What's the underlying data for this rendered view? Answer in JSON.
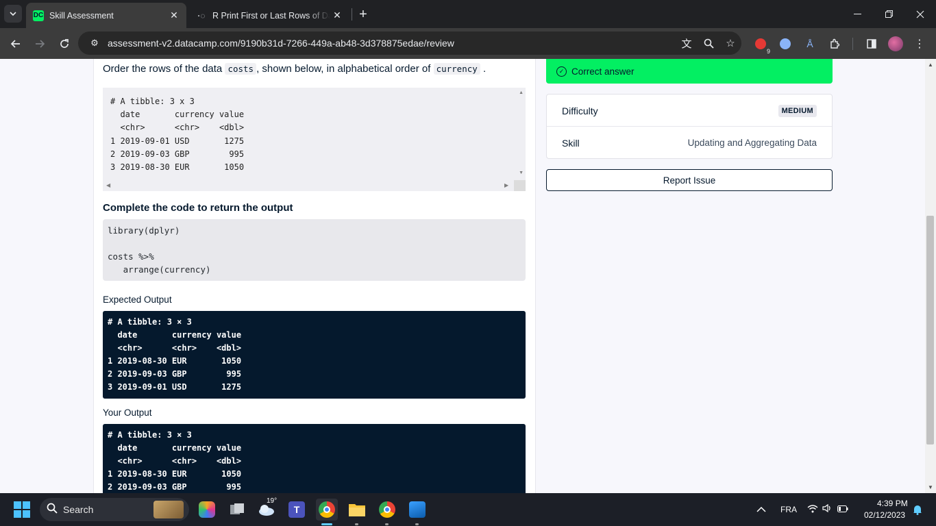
{
  "browser": {
    "tabs": [
      {
        "title": "Skill Assessment",
        "active": true
      },
      {
        "title": "R Print First or Last Rows of Da",
        "active": false
      }
    ],
    "url": "assessment-v2.datacamp.com/9190b31d-7266-449a-ab48-3d378875edae/review",
    "extension_badge": "9"
  },
  "question": {
    "text_before": "Order the rows of the data",
    "code1": "costs",
    "text_middle": ", shown below, in alphabetical order of",
    "code2": "currency",
    "text_after": ".",
    "data_preview": "# A tibble: 3 x 3\n  date       currency value\n  <chr>      <chr>    <dbl>\n1 2019-09-01 USD       1275\n2 2019-09-03 GBP        995\n3 2019-08-30 EUR       1050"
  },
  "complete": {
    "heading": "Complete the code to return the output",
    "code": "library(dplyr)\n\ncosts %>%\n   arrange(currency)"
  },
  "expected": {
    "heading": "Expected Output",
    "output": "# A tibble: 3 × 3\n  date       currency value\n  <chr>      <chr>    <dbl>\n1 2019-08-30 EUR       1050\n2 2019-09-03 GBP        995\n3 2019-09-01 USD       1275"
  },
  "yours": {
    "heading": "Your Output",
    "output": "# A tibble: 3 × 3\n  date       currency value\n  <chr>      <chr>    <dbl>\n1 2019-08-30 EUR       1050\n2 2019-09-03 GBP        995"
  },
  "result": {
    "banner": "Correct answer",
    "difficulty_label": "Difficulty",
    "difficulty_value": "MEDIUM",
    "skill_label": "Skill",
    "skill_value": "Updating and Aggregating Data",
    "report_button": "Report Issue"
  },
  "taskbar": {
    "search": "Search",
    "weather": "19°",
    "language": "FRA",
    "time": "4:39 PM",
    "date": "02/12/2023"
  },
  "colors": {
    "accent_green": "#03ef62",
    "navy": "#05192d"
  }
}
